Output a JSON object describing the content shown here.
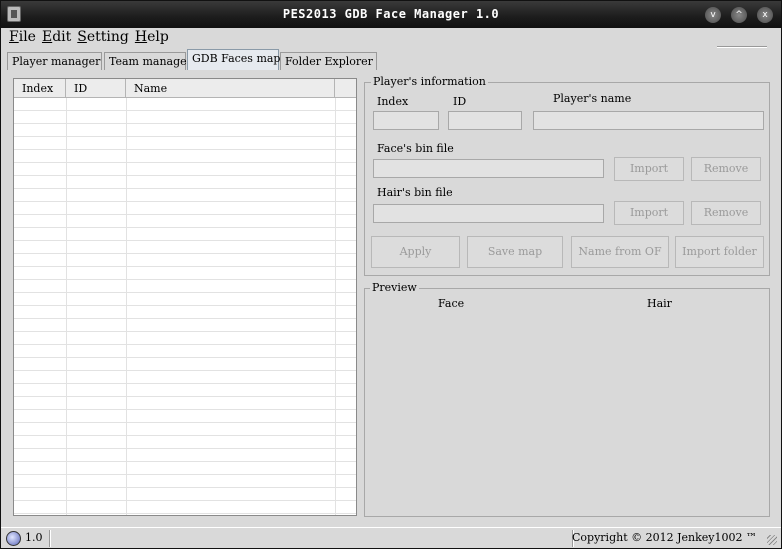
{
  "window": {
    "title": "PES2013 GDB Face Manager 1.0",
    "minimize_symbol": "v",
    "maximize_symbol": "^",
    "close_symbol": "x"
  },
  "menu": {
    "items": [
      "File",
      "Edit",
      "Setting",
      "Help"
    ]
  },
  "tabs": [
    {
      "label": "Player manager",
      "active": false
    },
    {
      "label": "Team manager",
      "active": false
    },
    {
      "label": "GDB Faces map",
      "active": true
    },
    {
      "label": "Folder Explorer",
      "active": false
    }
  ],
  "table": {
    "columns": [
      "Index",
      "ID",
      "Name"
    ],
    "rows": []
  },
  "player_info": {
    "title": "Player's information",
    "index_label": "Index",
    "id_label": "ID",
    "name_label": "Player's name",
    "face_label": "Face's bin file",
    "hair_label": "Hair's bin file",
    "import_label": "Import",
    "remove_label": "Remove",
    "apply_label": "Apply",
    "save_map_label": "Save map",
    "name_from_of_label": "Name from OF",
    "import_folder_label": "Import folder",
    "index_value": "",
    "id_value": "",
    "name_value": "",
    "face_value": "",
    "hair_value": ""
  },
  "preview": {
    "title": "Preview",
    "face_label": "Face",
    "hair_label": "Hair"
  },
  "status": {
    "version": "1.0",
    "copyright": "Copyright © 2012 Jenkey1002 ™"
  },
  "colors": {
    "titlebar": "#1c1c1c",
    "window_bg": "#d9d9d9",
    "disabled_text": "#9a9a9a"
  }
}
